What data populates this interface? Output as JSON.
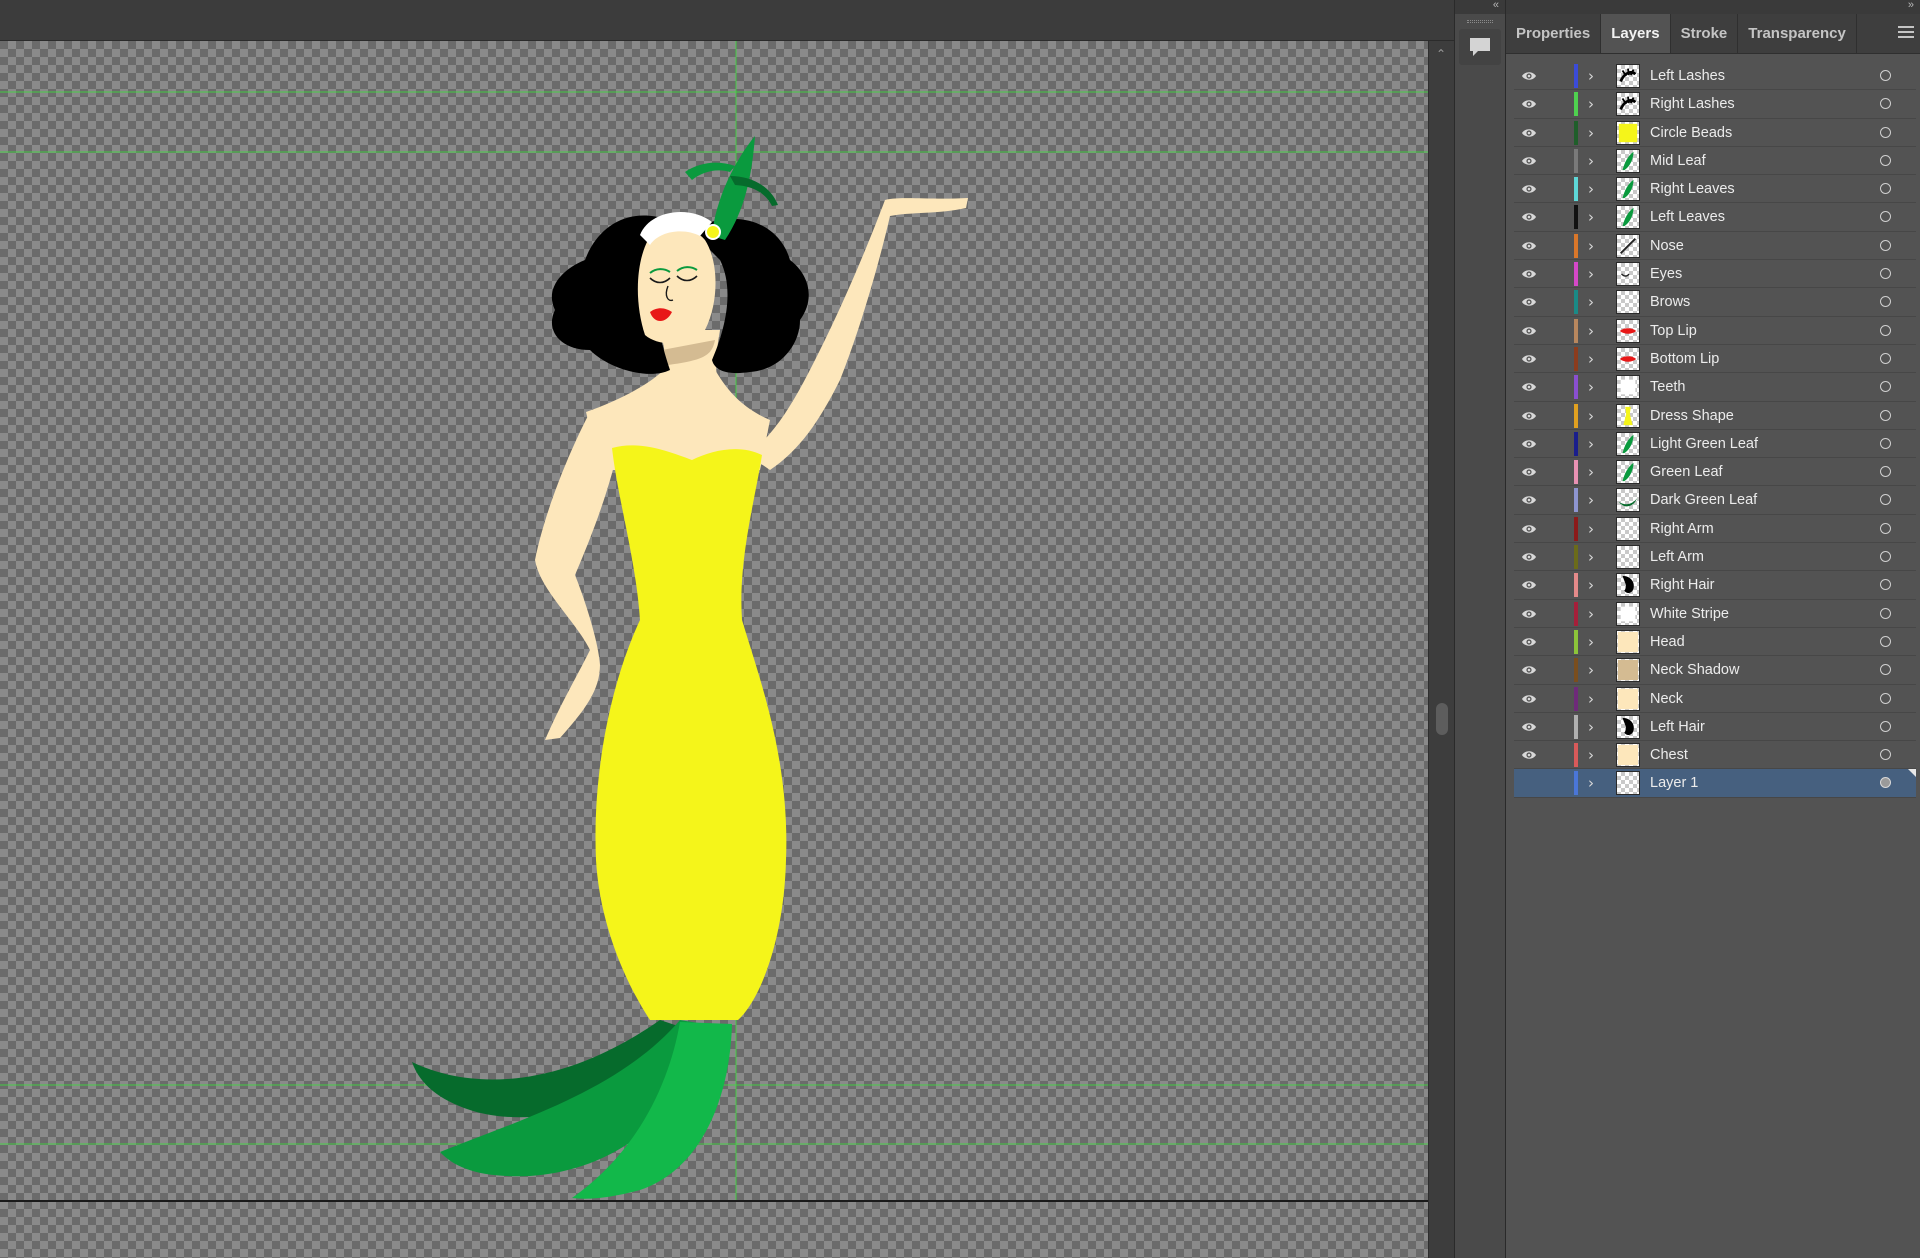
{
  "panel": {
    "tabs": [
      {
        "label": "Properties",
        "active": false
      },
      {
        "label": "Layers",
        "active": true
      },
      {
        "label": "Stroke",
        "active": false
      },
      {
        "label": "Transparency",
        "active": false
      }
    ],
    "collapse_glyph": "«",
    "expand_glyph": "»",
    "menu_icon": "hamburger-menu-icon"
  },
  "dock": {
    "comment_icon": "comment-icon"
  },
  "layers": [
    {
      "name": "Left Lashes",
      "color": "#3b4bd8",
      "visible": true,
      "thumb": "lashes"
    },
    {
      "name": "Right Lashes",
      "color": "#4fd14f",
      "visible": true,
      "thumb": "lashes"
    },
    {
      "name": "Circle Beads",
      "color": "#1f5e2a",
      "visible": true,
      "thumb": "yellow"
    },
    {
      "name": "Mid Leaf",
      "color": "#7a7a7a",
      "visible": true,
      "thumb": "leaf"
    },
    {
      "name": "Right Leaves",
      "color": "#5ed8d8",
      "visible": true,
      "thumb": "leaf"
    },
    {
      "name": "Left Leaves",
      "color": "#111111",
      "visible": true,
      "thumb": "leaf"
    },
    {
      "name": "Nose",
      "color": "#d9772a",
      "visible": true,
      "thumb": "line"
    },
    {
      "name": "Eyes",
      "color": "#d548c8",
      "visible": true,
      "thumb": "dots"
    },
    {
      "name": "Brows",
      "color": "#1a8a86",
      "visible": true,
      "thumb": "empty"
    },
    {
      "name": "Top Lip",
      "color": "#b8875e",
      "visible": true,
      "thumb": "lip"
    },
    {
      "name": "Bottom Lip",
      "color": "#8c3c1d",
      "visible": true,
      "thumb": "lip"
    },
    {
      "name": "Teeth",
      "color": "#8a4fd0",
      "visible": true,
      "thumb": "white"
    },
    {
      "name": "Dress Shape",
      "color": "#e0a020",
      "visible": true,
      "thumb": "dress"
    },
    {
      "name": "Light Green Leaf",
      "color": "#1a1e8c",
      "visible": true,
      "thumb": "leaf"
    },
    {
      "name": "Green Leaf",
      "color": "#e891b3",
      "visible": true,
      "thumb": "leaf"
    },
    {
      "name": "Dark Green Leaf",
      "color": "#8e95d0",
      "visible": true,
      "thumb": "darkleaf"
    },
    {
      "name": "Right Arm",
      "color": "#8c1a1a",
      "visible": true,
      "thumb": "empty"
    },
    {
      "name": "Left Arm",
      "color": "#6b6b1a",
      "visible": true,
      "thumb": "empty"
    },
    {
      "name": "Right Hair",
      "color": "#e48a8a",
      "visible": true,
      "thumb": "hair"
    },
    {
      "name": "White Stripe",
      "color": "#a51f3a",
      "visible": true,
      "thumb": "white"
    },
    {
      "name": "Head",
      "color": "#8cc43a",
      "visible": true,
      "thumb": "skin"
    },
    {
      "name": "Neck Shadow",
      "color": "#7a4e1e",
      "visible": true,
      "thumb": "shadow"
    },
    {
      "name": "Neck",
      "color": "#6e2a7a",
      "visible": true,
      "thumb": "skin"
    },
    {
      "name": "Left Hair",
      "color": "#b0b0b0",
      "visible": true,
      "thumb": "hair"
    },
    {
      "name": "Chest",
      "color": "#d85a5a",
      "visible": true,
      "thumb": "skin"
    },
    {
      "name": "Layer 1",
      "color": "#4a76d8",
      "visible": false,
      "thumb": "empty",
      "selected": true
    }
  ],
  "artwork": {
    "description_icon": "illustration",
    "colors": {
      "skin": "#fde7bb",
      "dress": "#f5f51a",
      "hair": "#000000",
      "leaf_dark": "#066b2c",
      "leaf_mid": "#0a9a3e",
      "leaf_light": "#12b84a",
      "lips": "#e81818",
      "guide": "#3ddc3d"
    }
  }
}
